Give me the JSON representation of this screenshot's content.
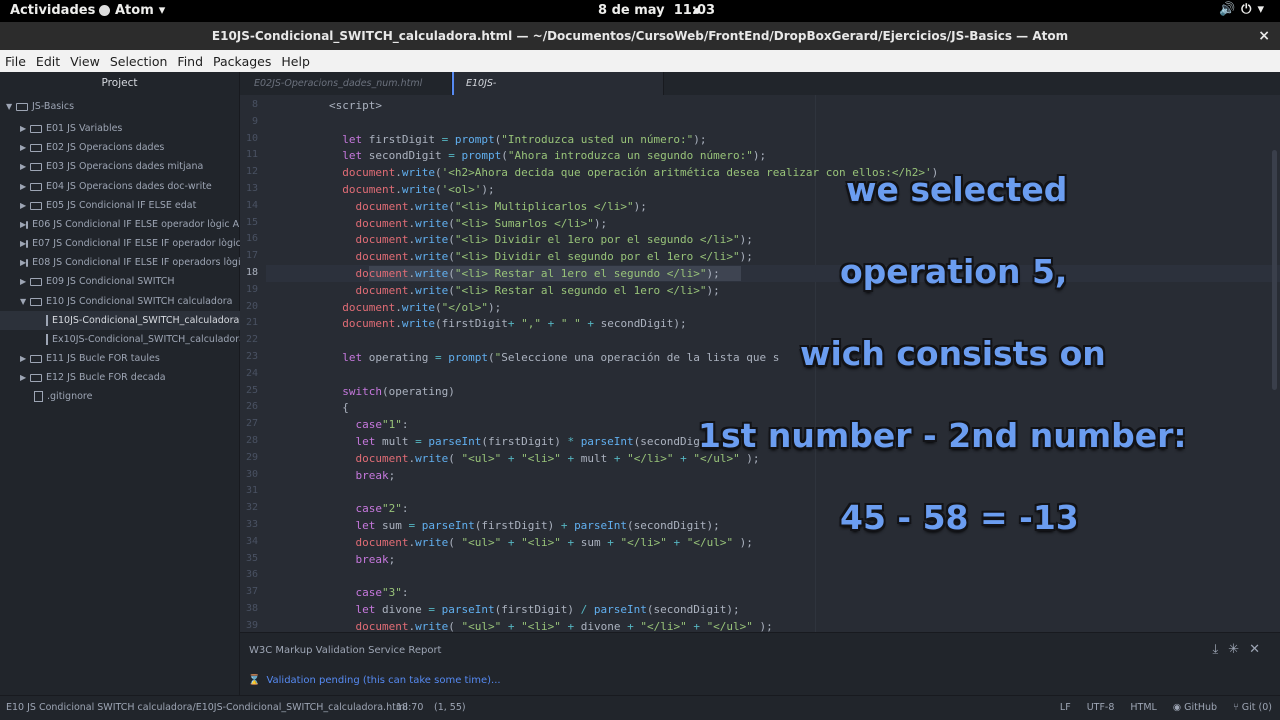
{
  "topbar": {
    "activities": "Actividades",
    "app_name": "Atom",
    "date": "8 de may",
    "time": "11:03"
  },
  "window": {
    "title": "E10JS-Condicional_SWITCH_calculadora.html — ~/Documentos/CursoWeb/FrontEnd/DropBoxGerard/Ejercicios/JS-Basics — Atom",
    "close": "×"
  },
  "menu": [
    "File",
    "Edit",
    "View",
    "Selection",
    "Find",
    "Packages",
    "Help"
  ],
  "tree": {
    "title": "Project",
    "root": "JS-Basics",
    "items": [
      {
        "label": "E01 JS Variables",
        "type": "folder"
      },
      {
        "label": "E02 JS Operacions dades",
        "type": "folder"
      },
      {
        "label": "E03 JS Operacions dades mitjana",
        "type": "folder"
      },
      {
        "label": "E04 JS Operacions dades doc-write",
        "type": "folder"
      },
      {
        "label": "E05 JS Condicional IF ELSE edat",
        "type": "folder"
      },
      {
        "label": "E06 JS Condicional IF ELSE operador lògic AND",
        "type": "folder"
      },
      {
        "label": "E07 JS Condicional IF ELSE IF operador lògic OR",
        "type": "folder"
      },
      {
        "label": "E08 JS Condicional IF ELSE IF operadors lògics",
        "type": "folder"
      },
      {
        "label": "E09 JS Condicional SWITCH",
        "type": "folder"
      },
      {
        "label": "E10 JS Condicional SWITCH calculadora",
        "type": "folder-open"
      },
      {
        "label": "E10JS-Condicional_SWITCH_calculadora.html",
        "type": "file-selected"
      },
      {
        "label": "Ex10JS-Condicional_SWITCH_calculadora.pdf",
        "type": "file"
      },
      {
        "label": "E11 JS Bucle FOR taules",
        "type": "folder"
      },
      {
        "label": "E12 JS Bucle FOR decada",
        "type": "folder"
      },
      {
        "label": ".gitignore",
        "type": "plainfile"
      }
    ]
  },
  "tabs": [
    {
      "label": "E02JS-Operacions_dades_num.html",
      "active": false
    },
    {
      "label": "E10JS-Condicional_SWITCH_calculadora.ht...",
      "active": true
    }
  ],
  "editor": {
    "current_line": 18,
    "lines": [
      {
        "n": "8",
        "text": "        <script>"
      },
      {
        "n": "9",
        "text": ""
      },
      {
        "n": "10",
        "text": "          let firstDigit = prompt(\"Introduzca usted un número:\");"
      },
      {
        "n": "11",
        "text": "          let secondDigit = prompt(\"Ahora introduzca un segundo número:\");"
      },
      {
        "n": "12",
        "text": "          document.write('<h2>Ahora decida que operación aritmética desea realizar con ellos:</h2>')"
      },
      {
        "n": "13",
        "text": "          document.write('<ol>');"
      },
      {
        "n": "14",
        "text": "            document.write(\"<li> Multiplicarlos </li>\");"
      },
      {
        "n": "15",
        "text": "            document.write(\"<li> Sumarlos </li>\");"
      },
      {
        "n": "16",
        "text": "            document.write(\"<li> Dividir el 1ero por el segundo </li>\");"
      },
      {
        "n": "17",
        "text": "            document.write(\"<li> Dividir el segundo por el 1ero </li>\");"
      },
      {
        "n": "18",
        "text": "            document.write(\"<li> Restar al 1ero el segundo </li>\");"
      },
      {
        "n": "19",
        "text": "            document.write(\"<li> Restar al segundo el 1ero </li>\");"
      },
      {
        "n": "20",
        "text": "          document.write(\"</ol>\");"
      },
      {
        "n": "21",
        "text": "          document.write(firstDigit+ \",\" + \" \" + secondDigit);"
      },
      {
        "n": "22",
        "text": ""
      },
      {
        "n": "23",
        "text": "          let operating = prompt(\"Seleccione una operación de la lista que s"
      },
      {
        "n": "24",
        "text": ""
      },
      {
        "n": "25",
        "text": "          switch(operating)"
      },
      {
        "n": "26",
        "text": "          {"
      },
      {
        "n": "27",
        "text": "            case\"1\":"
      },
      {
        "n": "28",
        "text": "            let mult = parseInt(firstDigit) * parseInt(secondDig"
      },
      {
        "n": "29",
        "text": "            document.write( \"<ul>\" + \"<li>\" + mult + \"</li>\" + \"</ul>\" );"
      },
      {
        "n": "30",
        "text": "            break;"
      },
      {
        "n": "31",
        "text": ""
      },
      {
        "n": "32",
        "text": "            case\"2\":"
      },
      {
        "n": "33",
        "text": "            let sum = parseInt(firstDigit) + parseInt(secondDigit);"
      },
      {
        "n": "34",
        "text": "            document.write( \"<ul>\" + \"<li>\" + sum + \"</li>\" + \"</ul>\" );"
      },
      {
        "n": "35",
        "text": "            break;"
      },
      {
        "n": "36",
        "text": ""
      },
      {
        "n": "37",
        "text": "            case\"3\":"
      },
      {
        "n": "38",
        "text": "            let divone = parseInt(firstDigit) / parseInt(secondDigit);"
      },
      {
        "n": "39",
        "text": "            document.write( \"<ul>\" + \"<li>\" + divone + \"</li>\" + \"</ul>\" );"
      }
    ]
  },
  "overlay": {
    "line1": "we selected",
    "line2": "operation 5,",
    "line3": "wich consists on",
    "line4": "1st number - 2nd number:",
    "line5": "45 - 58 = -13"
  },
  "panel": {
    "title": "W3C Markup Validation Service Report",
    "status": "Validation pending (this can take some time)..."
  },
  "statusbar": {
    "path": "E10 JS Condicional SWITCH calculadora/E10JS-Condicional_SWITCH_calculadora.html",
    "cursor": "18:70",
    "selection": "(1, 55)",
    "line_ending": "LF",
    "encoding": "UTF-8",
    "grammar": "HTML",
    "github": "GitHub",
    "git": "Git (0)"
  },
  "colors": {
    "accent": "#568af2",
    "caption": "#6b9df0"
  }
}
